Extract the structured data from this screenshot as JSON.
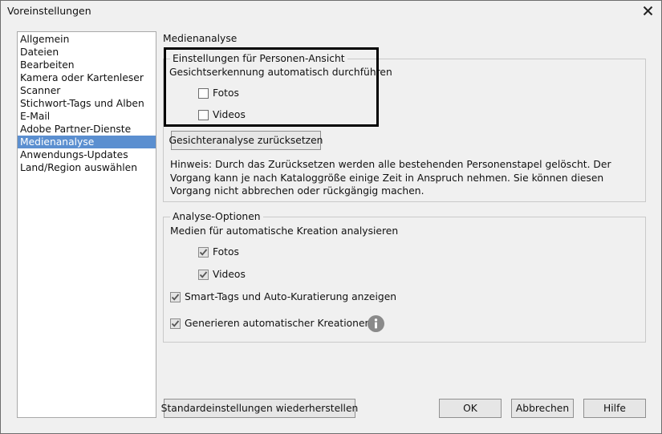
{
  "window": {
    "title": "Voreinstellungen"
  },
  "sidebar": {
    "items": [
      {
        "label": "Allgemein"
      },
      {
        "label": "Dateien"
      },
      {
        "label": "Bearbeiten"
      },
      {
        "label": "Kamera oder Kartenleser"
      },
      {
        "label": "Scanner"
      },
      {
        "label": "Stichwort-Tags und Alben"
      },
      {
        "label": "E-Mail"
      },
      {
        "label": "Adobe Partner-Dienste"
      },
      {
        "label": "Medienanalyse",
        "selected": true
      },
      {
        "label": "Anwendungs-Updates"
      },
      {
        "label": "Land/Region auswählen"
      }
    ]
  },
  "main": {
    "section_title": "Medienanalyse",
    "persons_group": {
      "legend": "Einstellungen für Personen-Ansicht",
      "face_detection_label": "Gesichtserkennung automatisch durchführen",
      "fotos": {
        "label": "Fotos",
        "checked": false
      },
      "videos": {
        "label": "Videos",
        "checked": false
      },
      "reset_button": "Gesichteranalyse zurücksetzen",
      "hint": "Hinweis: Durch das Zurücksetzen werden alle bestehenden Personenstapel gelöscht. Der Vorgang kann je nach Kataloggröße einige Zeit in Anspruch nehmen. Sie können diesen Vorgang nicht abbrechen oder rückgängig machen."
    },
    "analysis_group": {
      "legend": "Analyse-Optionen",
      "media_label": "Medien für automatische Kreation analysieren",
      "fotos": {
        "label": "Fotos",
        "checked": true
      },
      "videos": {
        "label": "Videos",
        "checked": true
      },
      "smart_tags": {
        "label": "Smart-Tags und Auto-Kuratierung anzeigen",
        "checked": true
      },
      "auto_creations": {
        "label": "Generieren automatischer Kreationen",
        "checked": true
      }
    }
  },
  "footer": {
    "restore_button": "Standardeinstellungen wiederherstellen",
    "ok_button": "OK",
    "cancel_button": "Abbrechen",
    "help_button": "Hilfe"
  },
  "icons": {
    "close": "close-icon",
    "info": "info-icon",
    "check": "checkmark-icon"
  }
}
